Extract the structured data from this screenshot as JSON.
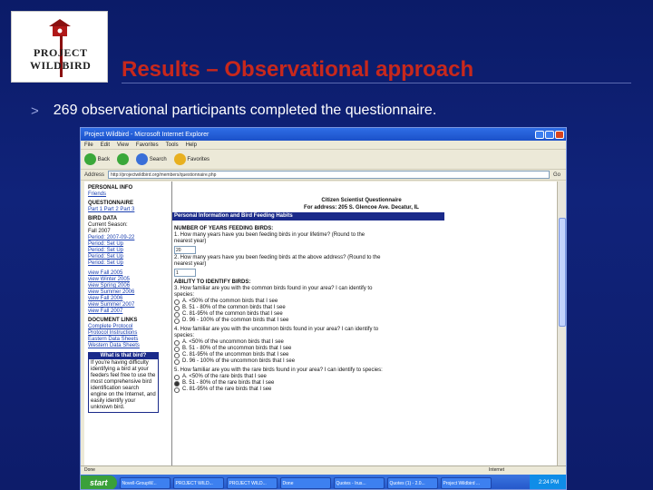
{
  "slide": {
    "title": "Results – Observational approach",
    "bullet_glyph": ">",
    "bullet_text": "269 observational participants completed the questionnaire.",
    "logo_line1": "PROJECT",
    "logo_line2": "WILDBIRD",
    "colors": {
      "background": "#0e1f6e",
      "title": "#c8281c",
      "text": "#ffffff"
    }
  },
  "browser": {
    "window_title": "Project Wildbird - Microsoft Internet Explorer",
    "menu": [
      "File",
      "Edit",
      "View",
      "Favorites",
      "Tools",
      "Help"
    ],
    "toolbar": {
      "back": "Back",
      "search": "Search",
      "favorites": "Favorites"
    },
    "address_label": "Address",
    "address_value": "http://projectwildbird.org/members/questionnaire.php",
    "go_label": "Go",
    "status_left": "Done",
    "status_right": "Internet"
  },
  "nav": {
    "personal_info_head": "PERSONAL INFO",
    "personal_links": [
      "Friends"
    ],
    "questionnaire_head": "QUESTIONNAIRE",
    "questionnaire_parts": "Part 1  Part 2  Part 3",
    "bird_data_head": "BIRD DATA",
    "current_season": "Current Season:",
    "season_value": "Fall 2007",
    "periods": [
      "Period: 2007-09-22",
      "Period: Set Up",
      "Period: Set Up",
      "Period: Set Up",
      "Period: Set Up"
    ],
    "views": [
      "view Fall 2005",
      "view Winter 2005",
      "view Spring 2006",
      "view Summer 2006",
      "view Fall 2006",
      "view Summer 2007",
      "view Fall 2007"
    ],
    "doc_head": "DOCUMENT LINKS",
    "doc_links": [
      "Complete Protocol",
      "Protocol Instructions",
      "Eastern Data Sheets",
      "Western Data Sheets"
    ],
    "help_head": "What is that bird?",
    "help_body": "If you're having difficulty identifying a bird at your feeders feel free to use the most comprehensive bird identification search engine on the Internet, and easily identify your unknown bird."
  },
  "form": {
    "header_line1": "Citizen Scientist Questionnaire",
    "header_line2": "For address: 205 S. Glencoe Ave. Decatur, IL",
    "section_title": "Personal Information and Bird Feeding Habits",
    "q_years_head": "NUMBER OF YEARS FEEDING BIRDS:",
    "q1": "1. How many years have you been feeding birds in your lifetime? (Round to the nearest year)",
    "q1_value": "20",
    "q2": "2. How many years have you been feeding birds at the above address? (Round to the nearest year)",
    "q2_value": "1",
    "q_ability_head": "ABILITY TO IDENTIFY BIRDS:",
    "q3": "3. How familiar are you with the common birds found in your area? I can identify to species:",
    "q3_options": [
      "A. <50% of the common birds that I see",
      "B. 51 - 80% of the common birds that I see",
      "C. 81-95% of the common birds that I see",
      "D. 96 - 100% of the common birds that I see"
    ],
    "q4": "4. How familiar are you with the uncommon birds found in your area? I can identify to species:",
    "q4_options": [
      "A. <50% of the uncommon birds that I see",
      "B. 51 - 80% of the uncommon birds that I see",
      "C. 81-95% of the uncommon birds that I see",
      "D. 96 - 100% of the uncommon birds that I see"
    ],
    "q5": "5. How familiar are you with the rare birds found in your area? I can identify to species:",
    "q5_options": [
      "A. <50% of the rare birds that I see",
      "B. 51 - 80% of the rare birds that I see",
      "C. 81-95% of the rare birds that I see"
    ]
  },
  "taskbar": {
    "start_label": "start",
    "tasks": [
      "Novell-GroupW...",
      "PROJECT WILD...",
      "PROJECT WILD...",
      "Done",
      "Quotes - Irus...",
      "Quotes (1) - 2.0...",
      "Project Wildbird ..."
    ],
    "clock": "2:24 PM"
  }
}
